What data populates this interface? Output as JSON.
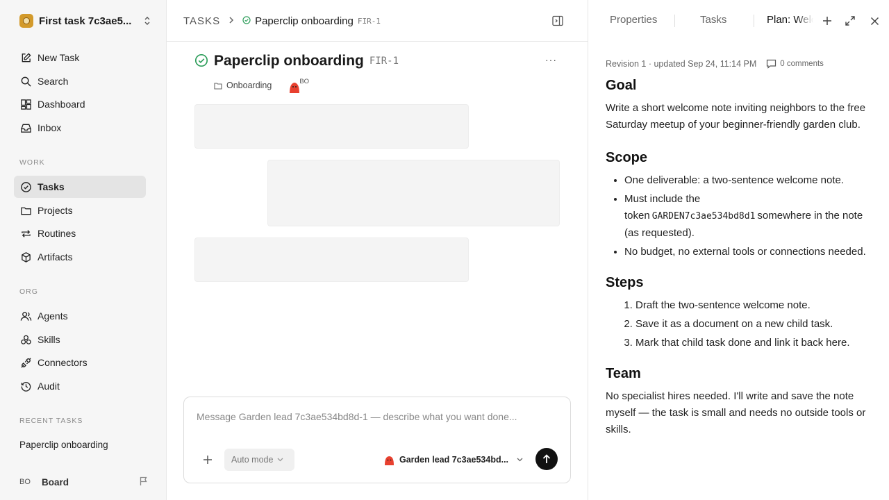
{
  "workspace": {
    "name": "First task 7c3ae5..."
  },
  "nav": [
    {
      "label": "New Task",
      "icon": "pencil-square-icon"
    },
    {
      "label": "Search",
      "icon": "search-icon"
    },
    {
      "label": "Dashboard",
      "icon": "dashboard-icon"
    },
    {
      "label": "Inbox",
      "icon": "inbox-icon"
    }
  ],
  "sections": {
    "work": "WORK",
    "org": "ORG",
    "recent": "RECENT TASKS"
  },
  "work_nav": [
    {
      "label": "Tasks",
      "icon": "check-circle-icon",
      "active": true
    },
    {
      "label": "Projects",
      "icon": "folder-icon"
    },
    {
      "label": "Routines",
      "icon": "repeat-icon"
    },
    {
      "label": "Artifacts",
      "icon": "cube-icon"
    }
  ],
  "org_nav": [
    {
      "label": "Agents",
      "icon": "users-icon"
    },
    {
      "label": "Skills",
      "icon": "skills-icon"
    },
    {
      "label": "Connectors",
      "icon": "plug-icon"
    },
    {
      "label": "Audit",
      "icon": "history-icon"
    }
  ],
  "recent_tasks": [
    "Paperclip onboarding"
  ],
  "board": {
    "avatar": "BO",
    "label": "Board"
  },
  "breadcrumb": {
    "root": "TASKS",
    "title": "Paperclip onboarding",
    "id": "FIR-1"
  },
  "task": {
    "title": "Paperclip onboarding",
    "id": "FIR-1",
    "project": "Onboarding",
    "assignee_initials": "BO",
    "more": "···"
  },
  "composer": {
    "placeholder": "Message Garden lead 7c3ae534bd8d-1 — describe what you want done...",
    "mode": "Auto mode",
    "agent": "Garden lead 7c3ae534bd..."
  },
  "right_panel": {
    "tabs": [
      "Properties",
      "Tasks",
      "Plan: Welc"
    ],
    "revision": "Revision 1 · updated Sep 24, 11:14 PM",
    "comments": "0 comments",
    "goal_heading": "Goal",
    "goal_text": "Write a short welcome note inviting neighbors to the free Saturday meetup of your beginner-friendly garden club.",
    "scope_heading": "Scope",
    "scope": {
      "item1": "One deliverable: a two-sentence welcome note.",
      "item2_before": "Must include the token",
      "item2_token": "GARDEN7c3ae534bd8d1",
      "item2_after": "somewhere in the note (as requested).",
      "item3": "No budget, no external tools or connections needed."
    },
    "steps_heading": "Steps",
    "steps": [
      "Draft the two-sentence welcome note.",
      "Save it as a document on a new child task.",
      "Mark that child task done and link it back here."
    ],
    "team_heading": "Team",
    "team_text": "No specialist hires needed. I'll write and save the note myself — the task is small and needs no outside tools or skills."
  },
  "colors": {
    "status_green": "#2e9e5b",
    "sidebar_bg": "#f6f6f6",
    "active_bg": "#e4e4e4"
  }
}
